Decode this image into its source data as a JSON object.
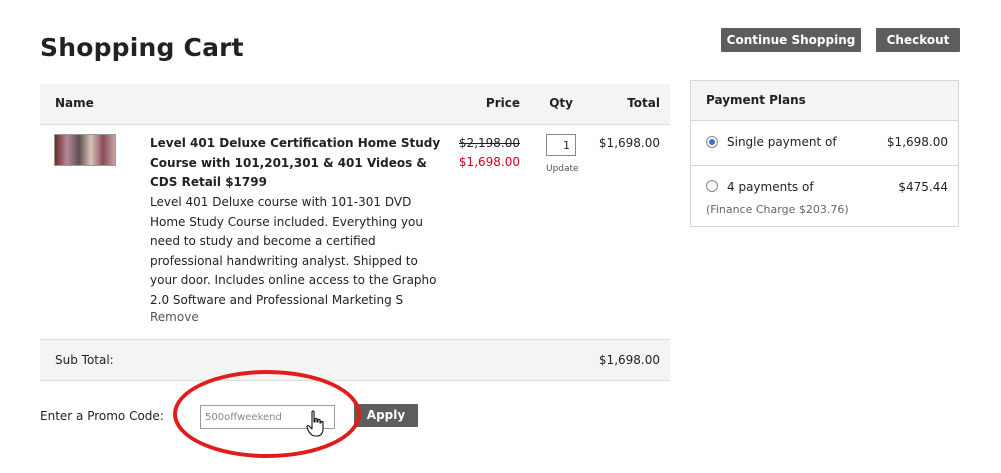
{
  "page": {
    "title": "Shopping Cart"
  },
  "header_buttons": {
    "continue_label": "Continue Shopping",
    "checkout_label": "Checkout"
  },
  "cart": {
    "columns": {
      "name": "Name",
      "price": "Price",
      "qty": "Qty",
      "total": "Total"
    },
    "items": [
      {
        "title": "Level 401 Deluxe Certification Home Study Course with 101,201,301 & 401 Videos & CDS Retail $1799",
        "description": "Level 401 Deluxe course with 101-301 DVD Home Study Course included. Everything you need to study and become a certified professional handwriting analyst. Shipped to your door. Includes online access to the Grapho 2.0 Software and Professional Marketing S",
        "remove_label": "Remove",
        "price_original": "$2,198.00",
        "price_sale": "$1,698.00",
        "quantity": "1",
        "update_label": "Update",
        "total": "$1,698.00"
      }
    ],
    "subtotal_label": "Sub Total:",
    "subtotal_value": "$1,698.00"
  },
  "promo": {
    "label": "Enter a Promo Code:",
    "value": "500offweekend",
    "apply_label": "Apply"
  },
  "payment_plans": {
    "title": "Payment Plans",
    "options": [
      {
        "label": "Single payment of",
        "amount": "$1,698.00",
        "selected": true
      },
      {
        "label": "4 payments of",
        "amount": "$475.44",
        "note": "(Finance Charge $203.76)",
        "selected": false
      }
    ]
  },
  "colors": {
    "button_bg": "#5d5d5d",
    "sale_price": "#d0021b",
    "highlight_circle": "#e21c1c",
    "radio_selected": "#3b6fd0"
  },
  "icons": {
    "cursor": "hand-pointer-icon"
  }
}
